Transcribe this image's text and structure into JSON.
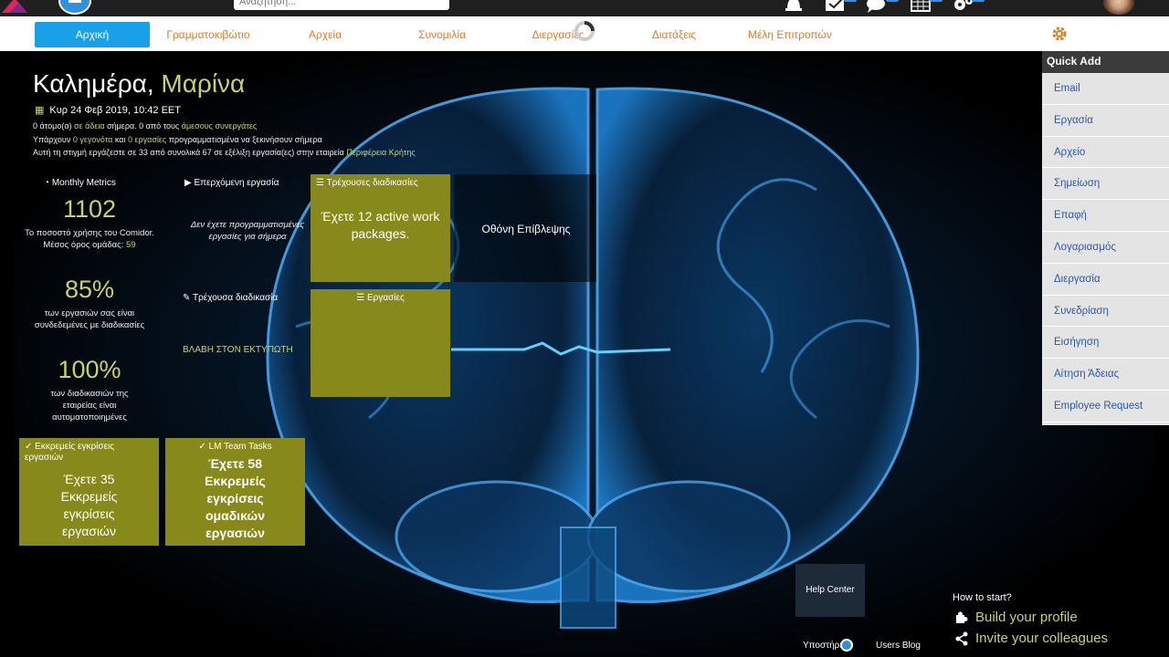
{
  "topbar": {
    "search_placeholder": "Αναζήτηση..."
  },
  "nav": {
    "items": [
      "Αρχική",
      "Γραμματοκιβώτιο",
      "Αρχεία",
      "Συνομιλία",
      "Διεργασίες",
      "Διατάξεις",
      "Μέλη Επιτροπών"
    ]
  },
  "greeting": {
    "prefix": "Καλημέρα,",
    "name": "Μαρίνα"
  },
  "date_line": "Κυρ 24 Φεβ 2019, 10:42 EET",
  "info": {
    "line1_a": "0 άτομο(α)",
    "line1_b": "σε άδεια",
    "line1_c": "σήμερα. 0 από τους",
    "line1_d": "άμεσους συνεργάτες",
    "line2_a": "Υπάρχουν",
    "line2_b": "0 γεγονότα",
    "line2_c": "και",
    "line2_d": "0 εργασίες",
    "line2_e": "προγραμματισμένα να ξεκινήσουν σήμερα",
    "line3_a": "Αυτή τη στιγμή εργάζεστε σε 33 από συνολικά 67 σε εξέλιξη εργασία(ες) στην εταιρεία",
    "line3_b": "Περιφέρεια Κρήτης"
  },
  "metrics": {
    "title": "Monthly Metrics",
    "m1_value": "1102",
    "m1_desc_a": "Το ποσοστό χρήσης του Comidor. Μέσος όρος ομάδας:",
    "m1_desc_b": "59",
    "m2_value": "85%",
    "m2_desc": "των εργασιών σας είναι συνδεδεμένες με διαδικασίες",
    "m3_value": "100%",
    "m3_desc": "των διαδικασιών της εταιρείας είναι αυτοματοποιημένες"
  },
  "widgets": {
    "next_task_title": "Επερχόμενη εργασία",
    "next_task_empty": "Δεν έχετε προγραμματισμένες εργασίες για σήμερα",
    "current_processes_title": "Τρέχουσες διαδικασίες",
    "current_processes_body": "Έχετε 12 active work packages.",
    "monitor_screen": "Οθόνη Επίβλεψης",
    "current_process_title": "Τρέχουσα διαδικασία",
    "current_process_link": "ΒΛΑΒΗ ΣΤΟΝ ΕΚΤΥΠΩΤΗ",
    "tasks_title": "Εργασίες",
    "pending_approvals_title": "Εκκρεμείς εγκρίσεις εργασιών",
    "pending_approvals_body": "Έχετε 35 Εκκρεμείς εγκρίσεις εργασιών",
    "team_tasks_title": "LM Team Tasks",
    "team_tasks_body": "Έχετε 58 Εκκρεμείς εγκρίσεις ομαδικών εργασιών"
  },
  "quick_add": {
    "title": "Quick Add",
    "items": [
      "Email",
      "Εργασία",
      "Αρχείο",
      "Σημείωση",
      "Επαφή",
      "Λογαριασμός",
      "Διεργασία",
      "Συνεδρίαση",
      "Εισήγηση",
      "Αίτηση Άδειας",
      "Employee Request"
    ]
  },
  "footer": {
    "help_center": "Help Center",
    "support": "Υποστήριξη",
    "users_blog": "Users Blog",
    "how_to_start": "How to start?",
    "build_profile": "Build your profile",
    "invite": "Invite your colleagues"
  },
  "colors": {
    "accent_blue": "#1aa0e8",
    "nav_orange": "#e07b22",
    "olive": "#878a1a",
    "highlight": "#c7d36a",
    "link_blue": "#2b5aa0"
  }
}
